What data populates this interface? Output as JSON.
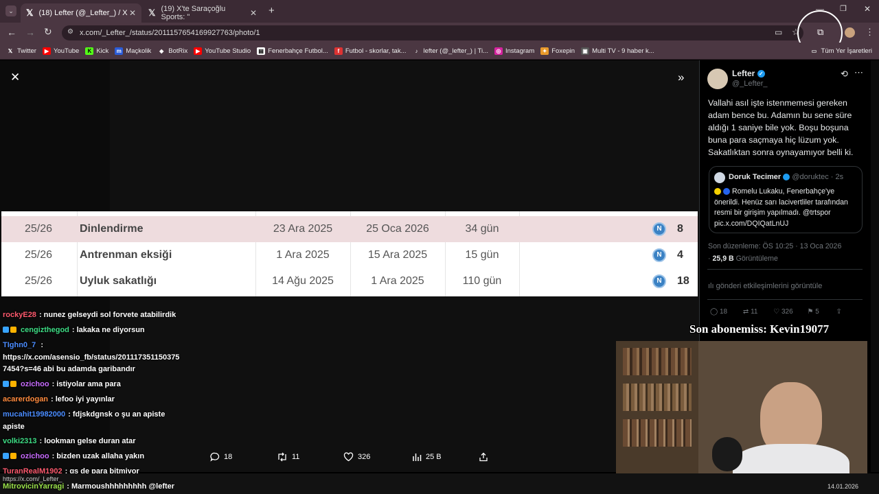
{
  "browser": {
    "tabs": [
      {
        "title": "(18) Lefter (@_Lefter_) / X",
        "active": true
      },
      {
        "title": "(19) X'te Saraçoğlu Sports: \"",
        "active": false
      }
    ],
    "url": "x.com/_Lefter_/status/2011157654169927763/photo/1",
    "bookmarks": [
      "Twitter",
      "YouTube",
      "Kick",
      "Maçkolik",
      "BotRix",
      "YouTube Studio",
      "Fenerbahçe Futbol...",
      "Futbol - skorlar, tak...",
      "lefter (@_lefter_) | Ti...",
      "Instagram",
      "Foxepin",
      "Multi TV - 9 haber k..."
    ],
    "bookmarks_all": "Tüm Yer İşaretleri",
    "status_link": "https://x.com/_Lefter_"
  },
  "table": {
    "rows": [
      {
        "season": "25/26",
        "reason": "Dinlendirme",
        "from": "23 Ara 2025",
        "to": "25 Oca 2026",
        "duration": "34 gün",
        "badge": "N",
        "games": "8",
        "highlight": true
      },
      {
        "season": "25/26",
        "reason": "Antrenman eksiği",
        "from": "1 Ara 2025",
        "to": "15 Ara 2025",
        "duration": "15 gün",
        "badge": "N",
        "games": "4",
        "highlight": false
      },
      {
        "season": "25/26",
        "reason": "Uyluk sakatlığı",
        "from": "14 Ağu 2025",
        "to": "1 Ara 2025",
        "duration": "110 gün",
        "badge": "N",
        "games": "18",
        "highlight": false
      }
    ]
  },
  "chat": [
    {
      "user": "rockyE28",
      "color": "#ff5a6e",
      "text": ": nunez gelseydi sol forvete atabilirdik",
      "badges": false
    },
    {
      "user": "cengizthegod",
      "color": "#3ddc84",
      "text": ": lakaka ne diyorsun",
      "badges": true
    },
    {
      "user": "TIghn0_7",
      "color": "#4a8cff",
      "text": " :",
      "badges": false
    },
    {
      "user": "",
      "color": "#fff",
      "text": "https://x.com/asensio_fb/status/201117351150375",
      "badges": false
    },
    {
      "user": "",
      "color": "#fff",
      "text": "7454?s=46 abi bu adamda garibandır",
      "badges": false
    },
    {
      "user": "ozichoo",
      "color": "#c86bff",
      "text": ": istiyolar ama para",
      "badges": true
    },
    {
      "user": "acarerdogan",
      "color": "#ff8a3d",
      "text": ": lefoo iyi yayınlar",
      "badges": false
    },
    {
      "user": "mucahit19982000",
      "color": "#4a8cff",
      "text": ": fdjskdgnsk o şu an apiste",
      "badges": false
    },
    {
      "user": "",
      "color": "#fff",
      "text": "apiste",
      "badges": false
    },
    {
      "user": "volki2313",
      "color": "#3ddc84",
      "text": ": lookman gelse duran atar",
      "badges": false
    },
    {
      "user": "ozichoo",
      "color": "#c86bff",
      "text": ": bizden uzak allaha yakın",
      "badges": true
    },
    {
      "user": "TuranRealM1902",
      "color": "#ff5a6e",
      "text": ": gs de para bitmiyor",
      "badges": false
    },
    {
      "user": "MitrovicinYarragi",
      "color": "#9be34a",
      "text": ": Marmoushhhhhhhhh @lefter",
      "badges": false
    }
  ],
  "actions": {
    "replies": "18",
    "retweets": "11",
    "likes": "326",
    "views": "25 B"
  },
  "tweet": {
    "name": "Lefter",
    "handle": "@_Lefter_",
    "text": "Vallahi asıl işte istenmemesi gereken adam bence bu. Adamın bu sene süre aldığı 1 saniye bile yok. Boşu boşuna buna para saçmaya hiç lüzum yok. Sakatlıktan sonra oynayamıyor belli ki.",
    "quote_name": "Doruk Tecimer",
    "quote_handle": "@doruktec · 2s",
    "quote_text": "Romelu Lukaku, Fenerbahçe'ye önerildi. Henüz sarı lacivertliler tarafından resmi bir girişim yapılmadı. @trtspor pic.x.com/DQIQatLnUJ",
    "edited": "Son düzenleme: ÖS 10:25 · 13 Oca 2026",
    "views_count": "25,9 B",
    "views_label": "Görüntüleme",
    "engagements": "gönderi etkileşimlerini görüntüle",
    "stats": {
      "replies": "18",
      "retweets": "11",
      "likes": "326",
      "bookmarks": "5"
    }
  },
  "overlay": {
    "sub_text": "Son abonemiss: Kevin19077"
  },
  "taskbar": {
    "date": "14.01.2026"
  },
  "colors": {
    "verified": "#1d9bf0",
    "table_highlight": "#eedcde",
    "badge_blue": "#3b82c4"
  }
}
